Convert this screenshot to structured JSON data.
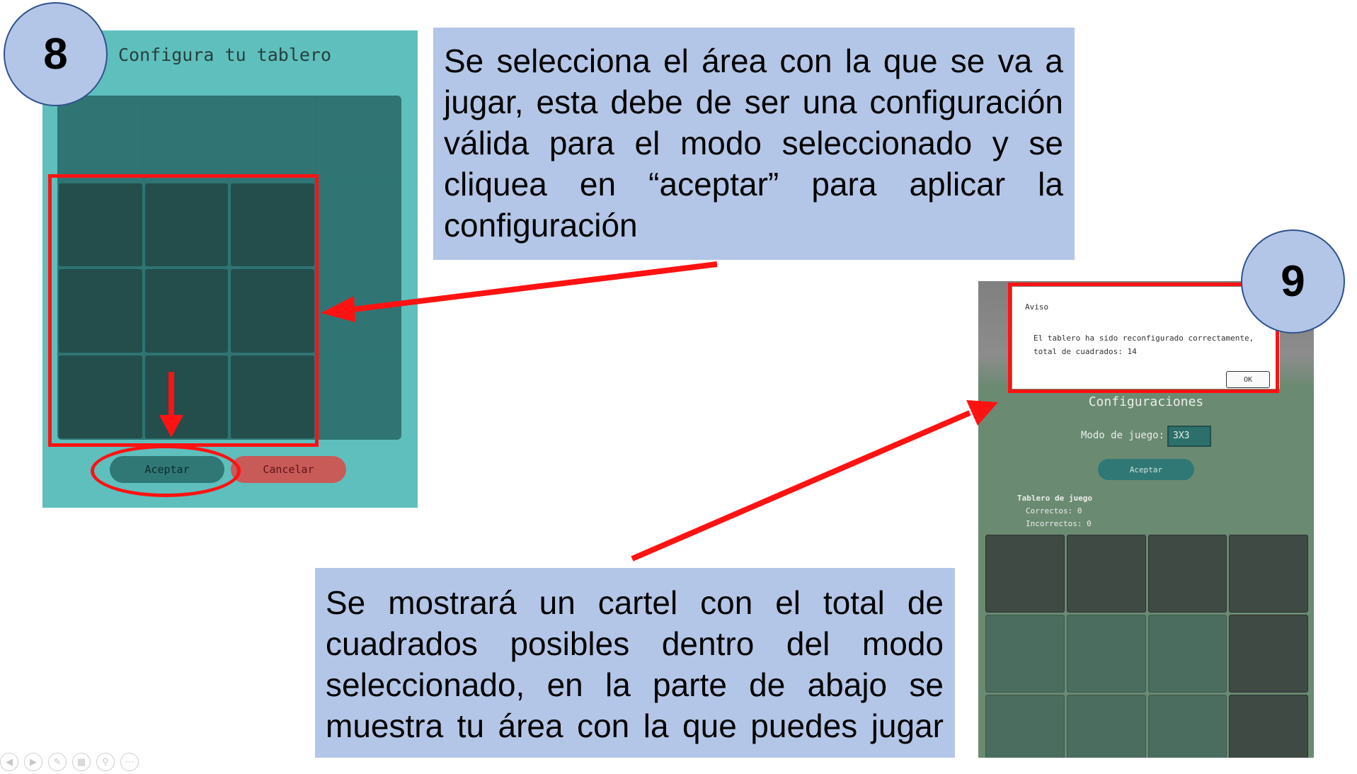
{
  "step8": {
    "badge": "8",
    "panel_title": "Configura tu tablero",
    "accept_label": "Aceptar",
    "cancel_label": "Cancelar"
  },
  "callout_top": "Se selecciona el área con la que se va a jugar, esta debe de ser una configuración válida para el modo seleccionado y se cliquea en “aceptar” para aplicar  la configuración",
  "step9": {
    "badge": "9",
    "dialog_title": "Aviso",
    "dialog_message": "El tablero ha sido reconfigurado correctamente, total de cuadrados: 14",
    "ok_label": "OK",
    "config_title": "Configuraciones",
    "mode_label": "Modo de juego:",
    "mode_value": "3X3",
    "accept_label": "Aceptar",
    "board_heading": "Tablero de juego",
    "correct_label": "Correctos: 0",
    "incorrect_label": "Incorrectos: 0"
  },
  "callout_bottom": "Se mostrará un cartel con el total de cuadrados posibles dentro del modo seleccionado, en la parte de abajo se muestra tu área con la que puedes jugar",
  "colors": {
    "highlight": "#ff1212",
    "callout_bg": "#b4c6e7",
    "panel8_bg": "#5fbfbd",
    "panel9_bg": "#6b8a72"
  },
  "slide_controls": [
    "prev-icon",
    "next-icon",
    "pen-icon",
    "slides-icon",
    "zoom-icon",
    "more-icon"
  ]
}
